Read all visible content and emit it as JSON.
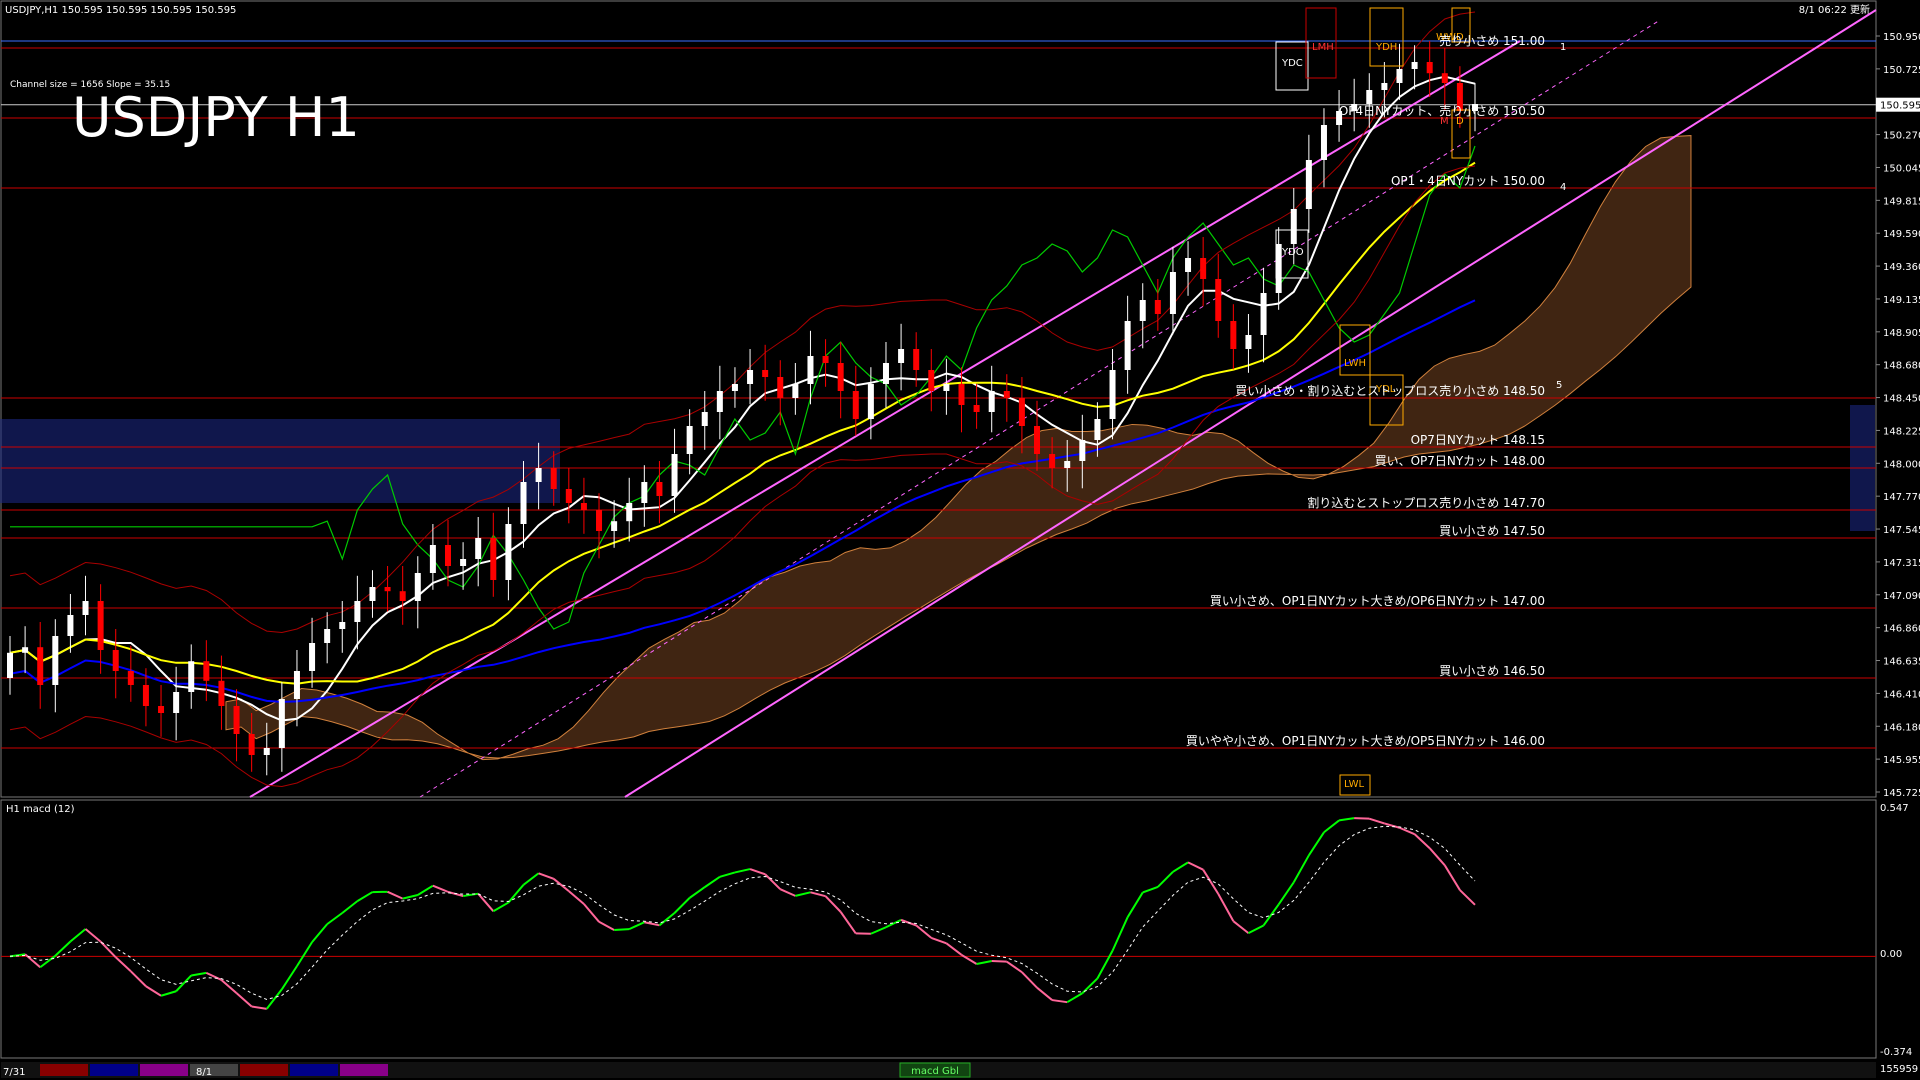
{
  "header": {
    "symbol_info": "USDJPY,H1  150.595 150.595 150.595 150.595",
    "datetime": "8/1 06:22 更新"
  },
  "chart_title": "USDJPY H1",
  "channel_info": "Channel size = 1656  Slope = 35.15",
  "price_axis": {
    "labels": [
      "150.950",
      "150.725",
      "150.500",
      "150.270",
      "150.045",
      "149.815",
      "149.590",
      "149.360",
      "149.135",
      "148.905",
      "148.680",
      "148.450",
      "148.225",
      "148.000",
      "147.770",
      "147.545",
      "147.315",
      "147.090",
      "146.860",
      "146.635",
      "146.410",
      "146.180",
      "145.955",
      "145.725"
    ],
    "current_price": "150.595"
  },
  "levels": [
    {
      "price": 151.0,
      "label": "売り小さめ 151.00"
    },
    {
      "price": 150.5,
      "label": "OP4日NYカット、売り小さめ 150.50"
    },
    {
      "price": 150.0,
      "label": "OP1・4日NYカット 150.00"
    },
    {
      "price": 148.5,
      "label": "買い小さめ・割り込むとストップロス売り小さめ 148.50"
    },
    {
      "price": 148.15,
      "label": "OP7日NYカット 148.15"
    },
    {
      "price": 148.0,
      "label": "買い、OP7日NYカット 148.00"
    },
    {
      "price": 147.7,
      "label": "割り込むとストップロス売り小さめ 147.70"
    },
    {
      "price": 147.5,
      "label": "買い小さめ 147.50"
    },
    {
      "price": 147.0,
      "label": "買い小さめ、OP1日NYカット大きめ/OP6日NYカット 147.00"
    },
    {
      "price": 146.5,
      "label": "買い小さめ 146.50"
    },
    {
      "price": 146.0,
      "label": "買いやや小さめ、OP1日NYカット大きめ/OP5日NYカット 146.00"
    }
  ],
  "box_labels": {
    "ydc_top": "YDC",
    "ydc_mid": "YDO",
    "lmh": "LMH",
    "ydh": "YDH",
    "ydl": "YDL",
    "lwh": "LWH",
    "lwl": "LWL",
    "ww": "WW",
    "d1": "D",
    "d2": "D",
    "m": "M",
    "wave_1": "1",
    "wave_4": "4",
    "wave_5": "5"
  },
  "macd_panel": {
    "label": "H1  macd (12)",
    "axis_labels": [
      "0.547",
      "0.00",
      "-0.374"
    ],
    "bottom_right": "155959",
    "tab": "macd Gbl"
  },
  "time_axis": {
    "labels": [
      "7/31",
      "8/1"
    ]
  },
  "colors": {
    "up_candle": "#ffffff",
    "down_candle": "#ff0000",
    "level_line": "#cc0000",
    "channel": "#ff66ff",
    "green_line": "#00cc00",
    "ma_fast": "#ffffff",
    "ma_mid": "#ffff00",
    "ma_slow": "#0000ff",
    "macd": "#00ff00",
    "macd_down": "#ff6699"
  },
  "chart_data": {
    "type": "candlestick",
    "title": "USDJPY H1",
    "ylim": [
      145.7,
      151.2
    ],
    "close": [
      146.68,
      146.72,
      146.45,
      146.8,
      146.95,
      147.05,
      146.7,
      146.55,
      146.45,
      146.3,
      146.25,
      146.4,
      146.62,
      146.48,
      146.3,
      146.1,
      145.95,
      146.0,
      146.35,
      146.55,
      146.75,
      146.85,
      146.9,
      147.05,
      147.15,
      147.12,
      147.05,
      147.25,
      147.45,
      147.3,
      147.35,
      147.5,
      147.2,
      147.6,
      147.9,
      148.0,
      147.85,
      147.75,
      147.7,
      147.55,
      147.62,
      147.75,
      147.9,
      147.8,
      148.1,
      148.3,
      148.4,
      148.55,
      148.6,
      148.7,
      148.65,
      148.5,
      148.6,
      148.8,
      148.75,
      148.55,
      148.35,
      148.6,
      148.75,
      148.85,
      148.7,
      148.55,
      148.6,
      148.45,
      148.4,
      148.55,
      148.5,
      148.3,
      148.1,
      148.0,
      148.05,
      148.2,
      148.35,
      148.7,
      149.05,
      149.2,
      149.1,
      149.4,
      149.5,
      149.35,
      149.05,
      148.85,
      148.95,
      149.25,
      149.6,
      149.85,
      150.2,
      150.45,
      150.55,
      150.6,
      150.7,
      150.75,
      150.85,
      150.9,
      150.82,
      150.75,
      150.55,
      150.6
    ],
    "open_first": 146.5,
    "annotations": [
      "YDC",
      "YDO",
      "LMH",
      "YDH",
      "YDL",
      "LWH",
      "LWL",
      "WW",
      "D",
      "M",
      "1",
      "4",
      "5"
    ]
  }
}
